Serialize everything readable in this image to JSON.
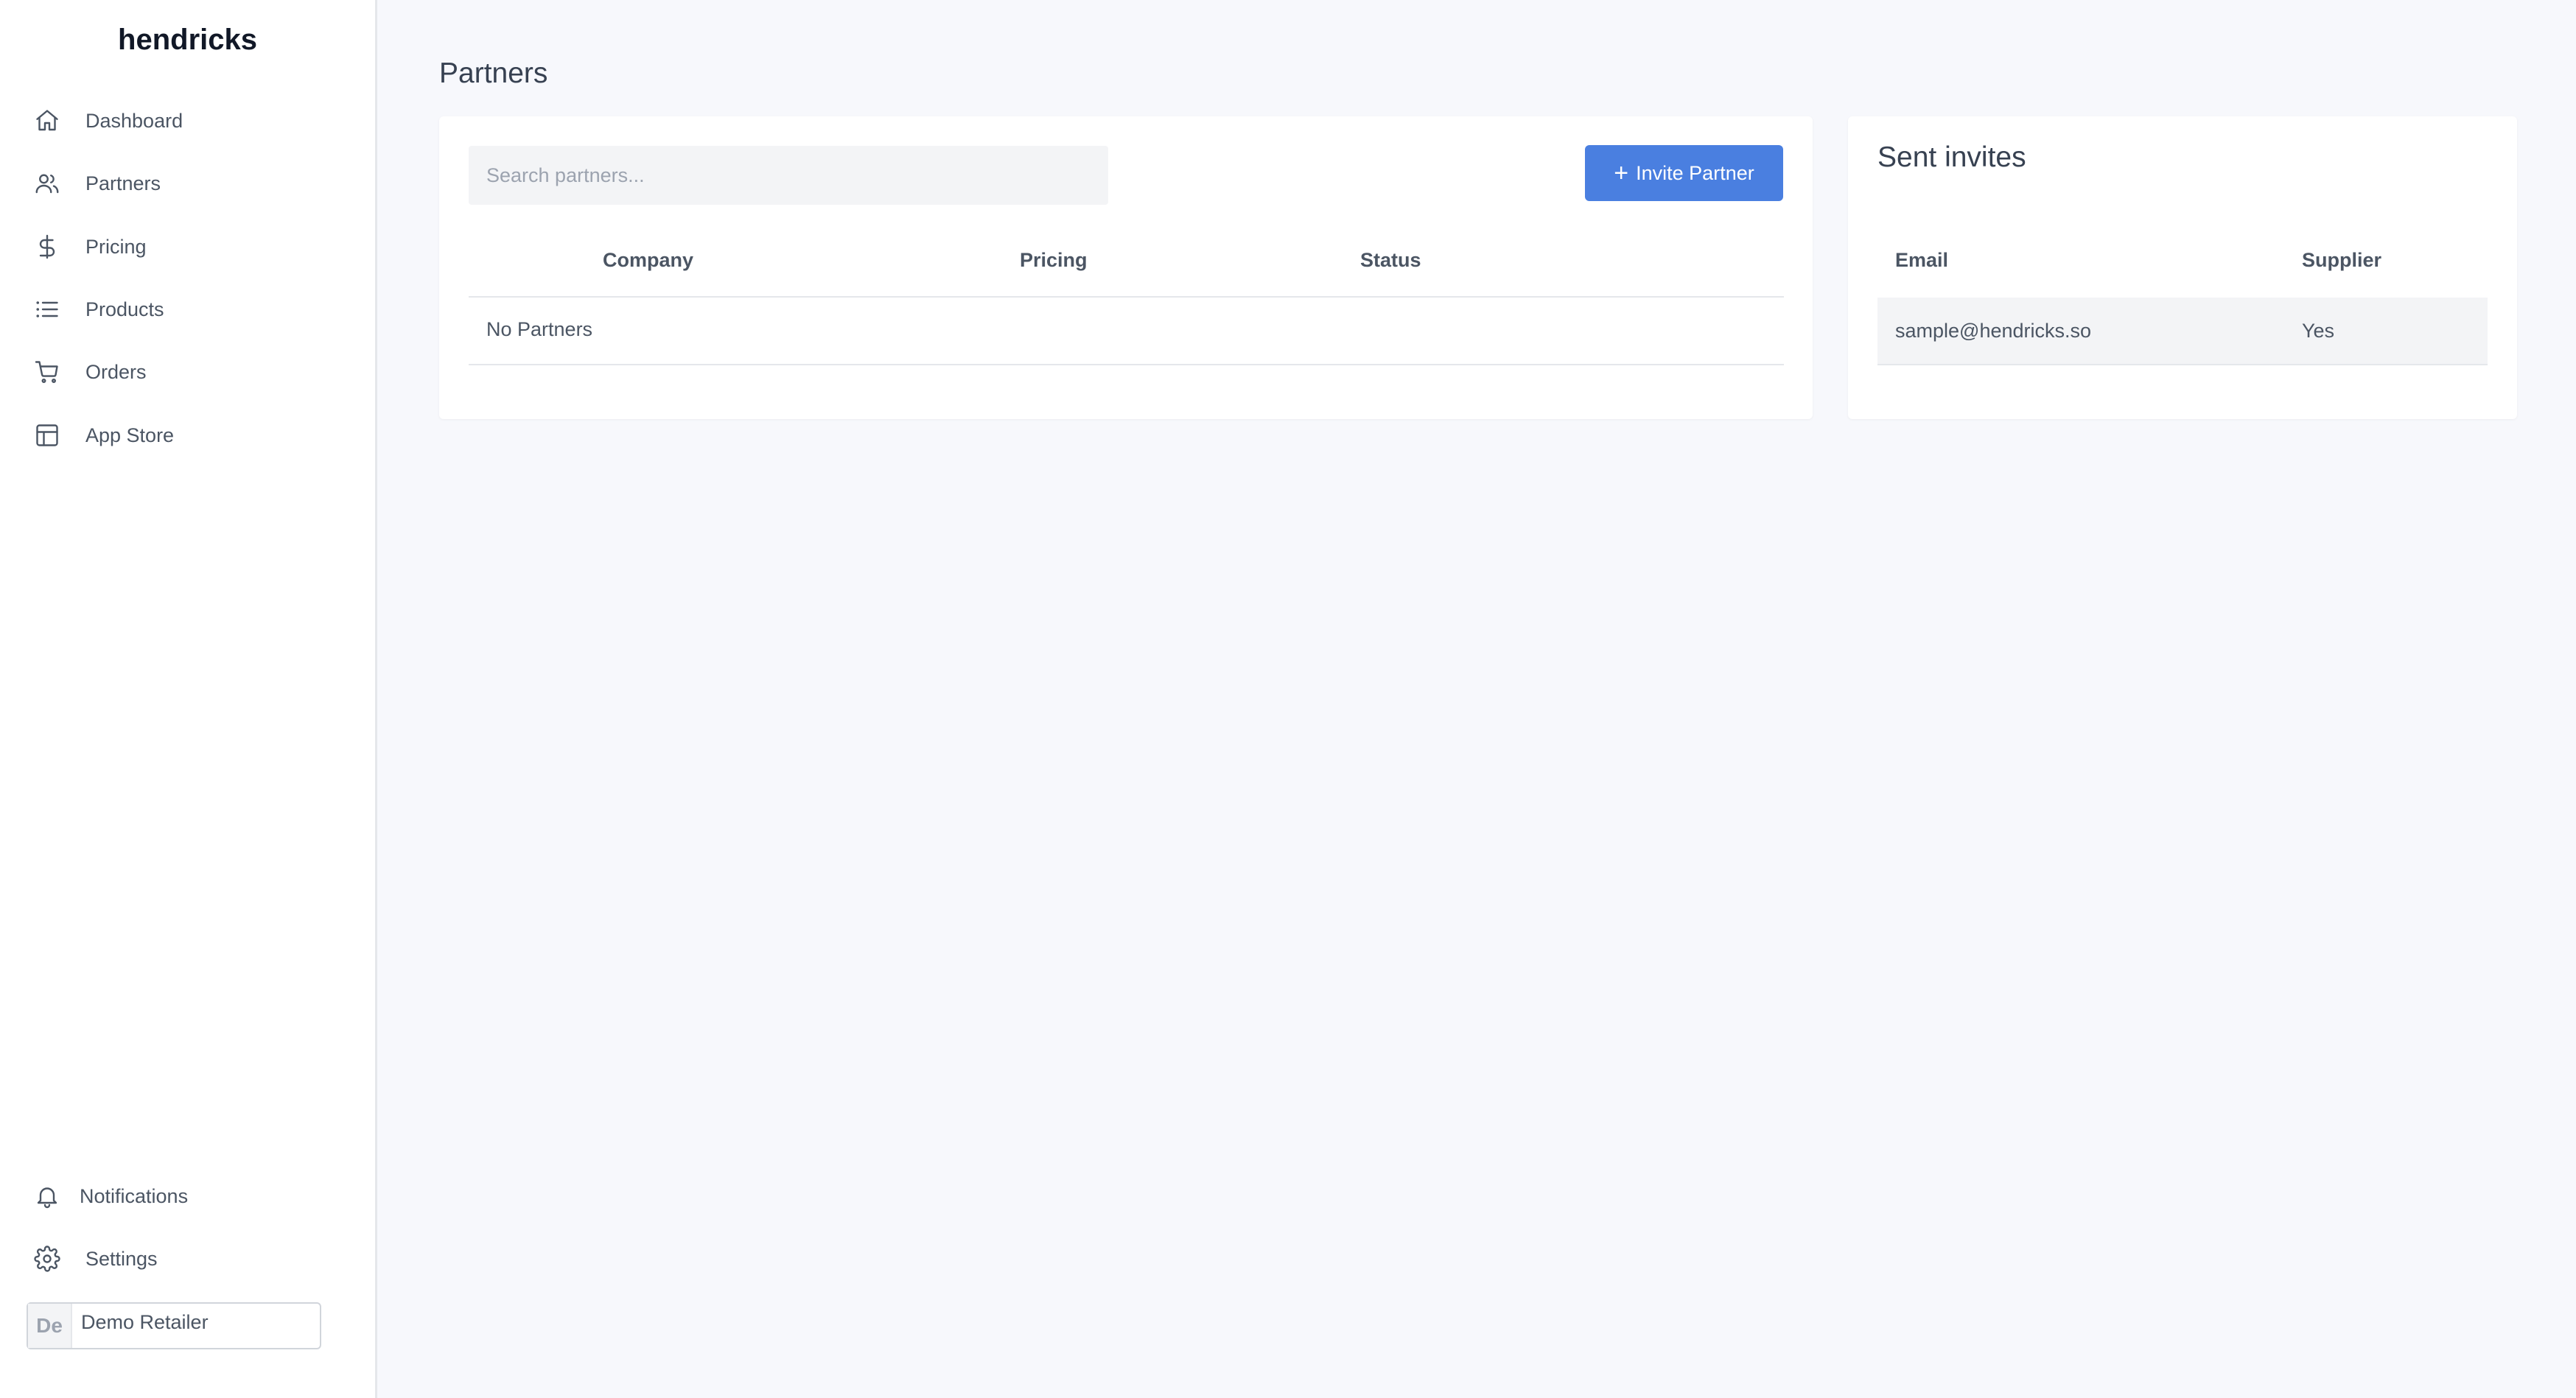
{
  "app": {
    "brand": "hendricks"
  },
  "sidebar": {
    "items": [
      {
        "label": "Dashboard",
        "icon": "home-icon"
      },
      {
        "label": "Partners",
        "icon": "users-icon"
      },
      {
        "label": "Pricing",
        "icon": "dollar-icon"
      },
      {
        "label": "Products",
        "icon": "list-icon"
      },
      {
        "label": "Orders",
        "icon": "cart-icon"
      },
      {
        "label": "App Store",
        "icon": "layout-icon"
      }
    ],
    "bottom": [
      {
        "label": "Notifications",
        "icon": "bell-icon"
      },
      {
        "label": "Settings",
        "icon": "gear-icon"
      }
    ],
    "account": {
      "initials": "De",
      "name": "Demo Retailer"
    }
  },
  "main": {
    "title": "Partners",
    "search": {
      "placeholder": "Search partners..."
    },
    "invite_button": "Invite Partner",
    "table": {
      "columns": [
        "Company",
        "Pricing",
        "Status"
      ],
      "empty_text": "No Partners"
    }
  },
  "invites": {
    "title": "Sent invites",
    "columns": [
      "Email",
      "Supplier"
    ],
    "rows": [
      {
        "email": "sample@hendricks.so",
        "supplier": "Yes"
      }
    ]
  },
  "colors": {
    "accent": "#4a7fe0",
    "background": "#f7f8fc"
  }
}
